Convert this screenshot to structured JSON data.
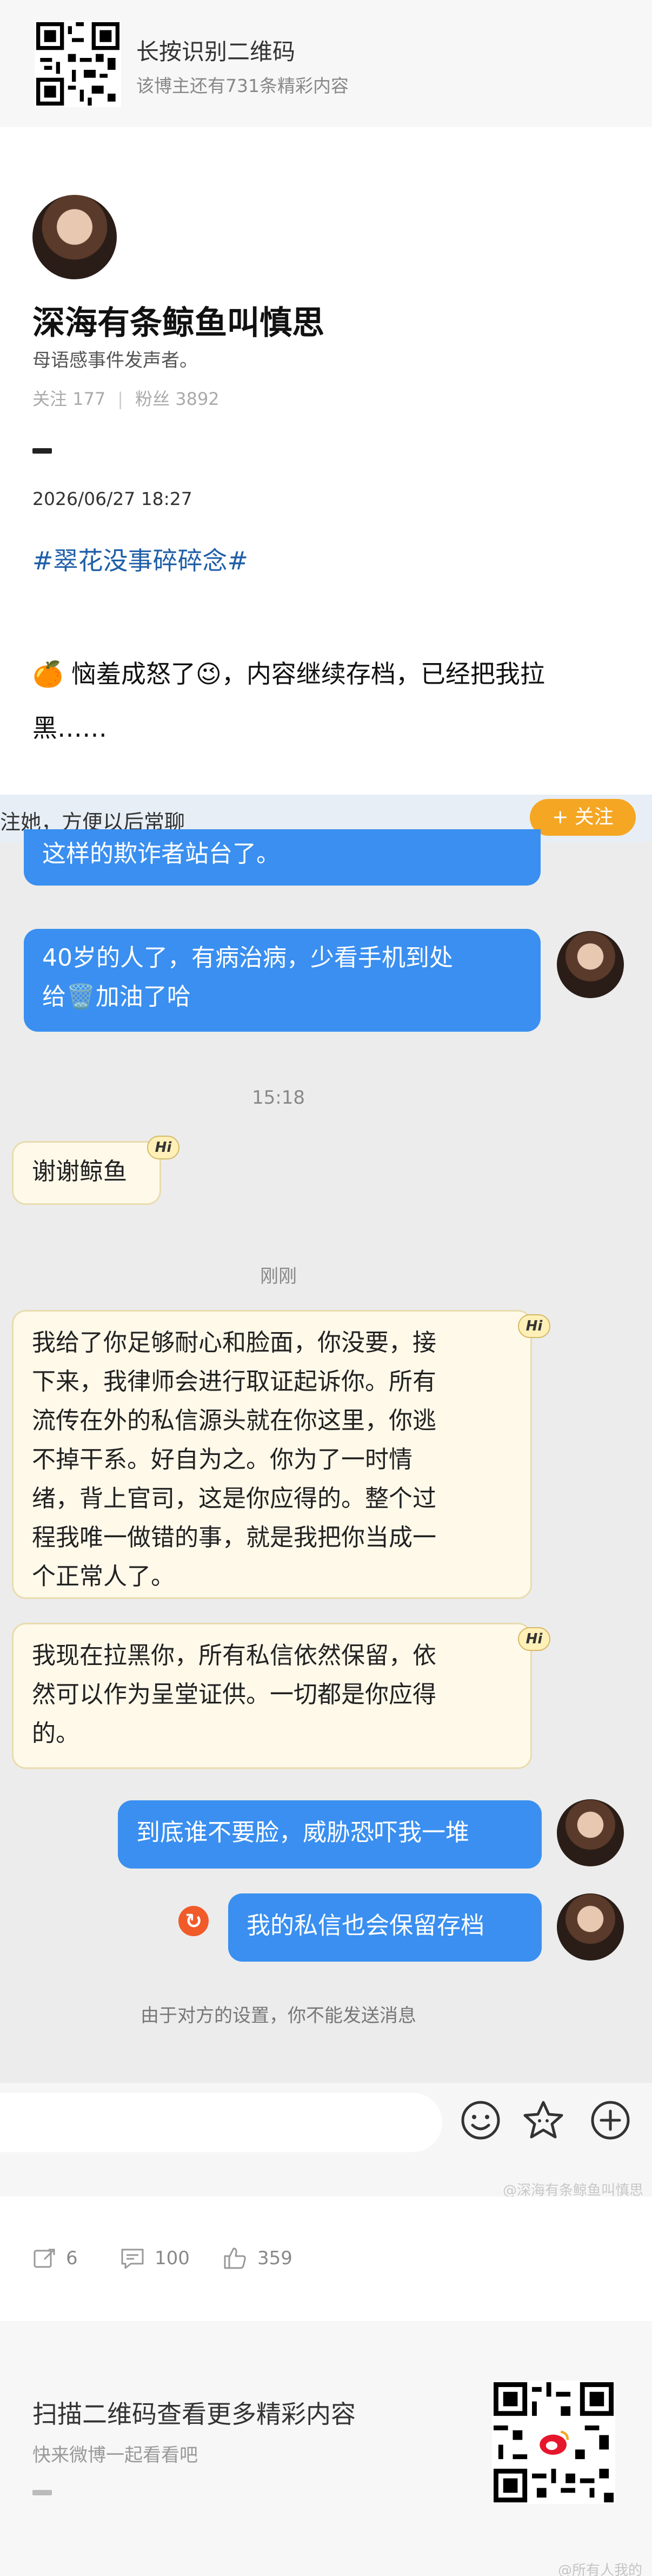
{
  "top_banner": {
    "title": "长按识别二维码",
    "subtitle": "该博主还有731条精彩内容",
    "qr_icon": "qr-code-icon"
  },
  "profile": {
    "nickname": "深海有条鲸鱼叫慎思",
    "bio": "母语感事件发声者。",
    "following_label": "关注 177",
    "followers_label": "粉丝 3892"
  },
  "post": {
    "date": "2026/06/27 18:27",
    "topic": "#翠花没事碎碎念#",
    "line1": "🍊 恼羞成怒了😉，内容继续存档，已经把我拉",
    "line2": "黑……"
  },
  "chat": {
    "notice_text": "注她，方便以后常聊",
    "follow_button": "+ 关注",
    "messages": [
      {
        "from": "me",
        "text": "这样的欺诈者站台了。"
      },
      {
        "from": "me",
        "line1": "40岁的人了，有病治病，少看手机到处",
        "line2": "给🗑️加油了哈"
      },
      {
        "time": "15:18"
      },
      {
        "from": "them",
        "text": "谢谢鲸鱼"
      },
      {
        "time": "刚刚"
      },
      {
        "from": "them",
        "lines": [
          "我给了你足够耐心和脸面，你没要，接",
          "下来，我律师会进行取证起诉你。所有",
          "流传在外的私信源头就在你这里，你逃",
          "不掉干系。好自为之。你为了一时情",
          "绪，背上官司，这是你应得的。整个过",
          "程我唯一做错的事，就是我把你当成一",
          "个正常人了。"
        ]
      },
      {
        "from": "them",
        "lines": [
          "我现在拉黑你，所有私信依然保留，依",
          "然可以作为呈堂证供。一切都是你应得",
          "的。"
        ]
      },
      {
        "from": "me",
        "text": "到底谁不要脸，威胁恐吓我一堆"
      },
      {
        "from": "me",
        "text": "我的私信也会保留存档",
        "status_icon": "retry-icon"
      }
    ],
    "badge": "Hi",
    "blocked_notice": "由于对方的设置，你不能发送消息"
  },
  "input_bar": {
    "icons": [
      "emoji-icon",
      "sticker-icon",
      "add-icon"
    ],
    "source_watermark": "@深海有条鲸鱼叫慎思"
  },
  "actions": {
    "repost_count": "6",
    "comment_count": "100",
    "like_count": "359"
  },
  "bottom_banner": {
    "title": "扫描二维码查看更多精彩内容",
    "subtitle": "快来微博一起看看吧",
    "watermark": "@所有人我的",
    "qr_icon": "weibo-qr-code-icon"
  },
  "colors": {
    "my_bubble": "#3a8ff0",
    "their_bubble": "#fff9ea",
    "topic_link": "#1f5fa8",
    "follow_button": "#f5a623"
  }
}
